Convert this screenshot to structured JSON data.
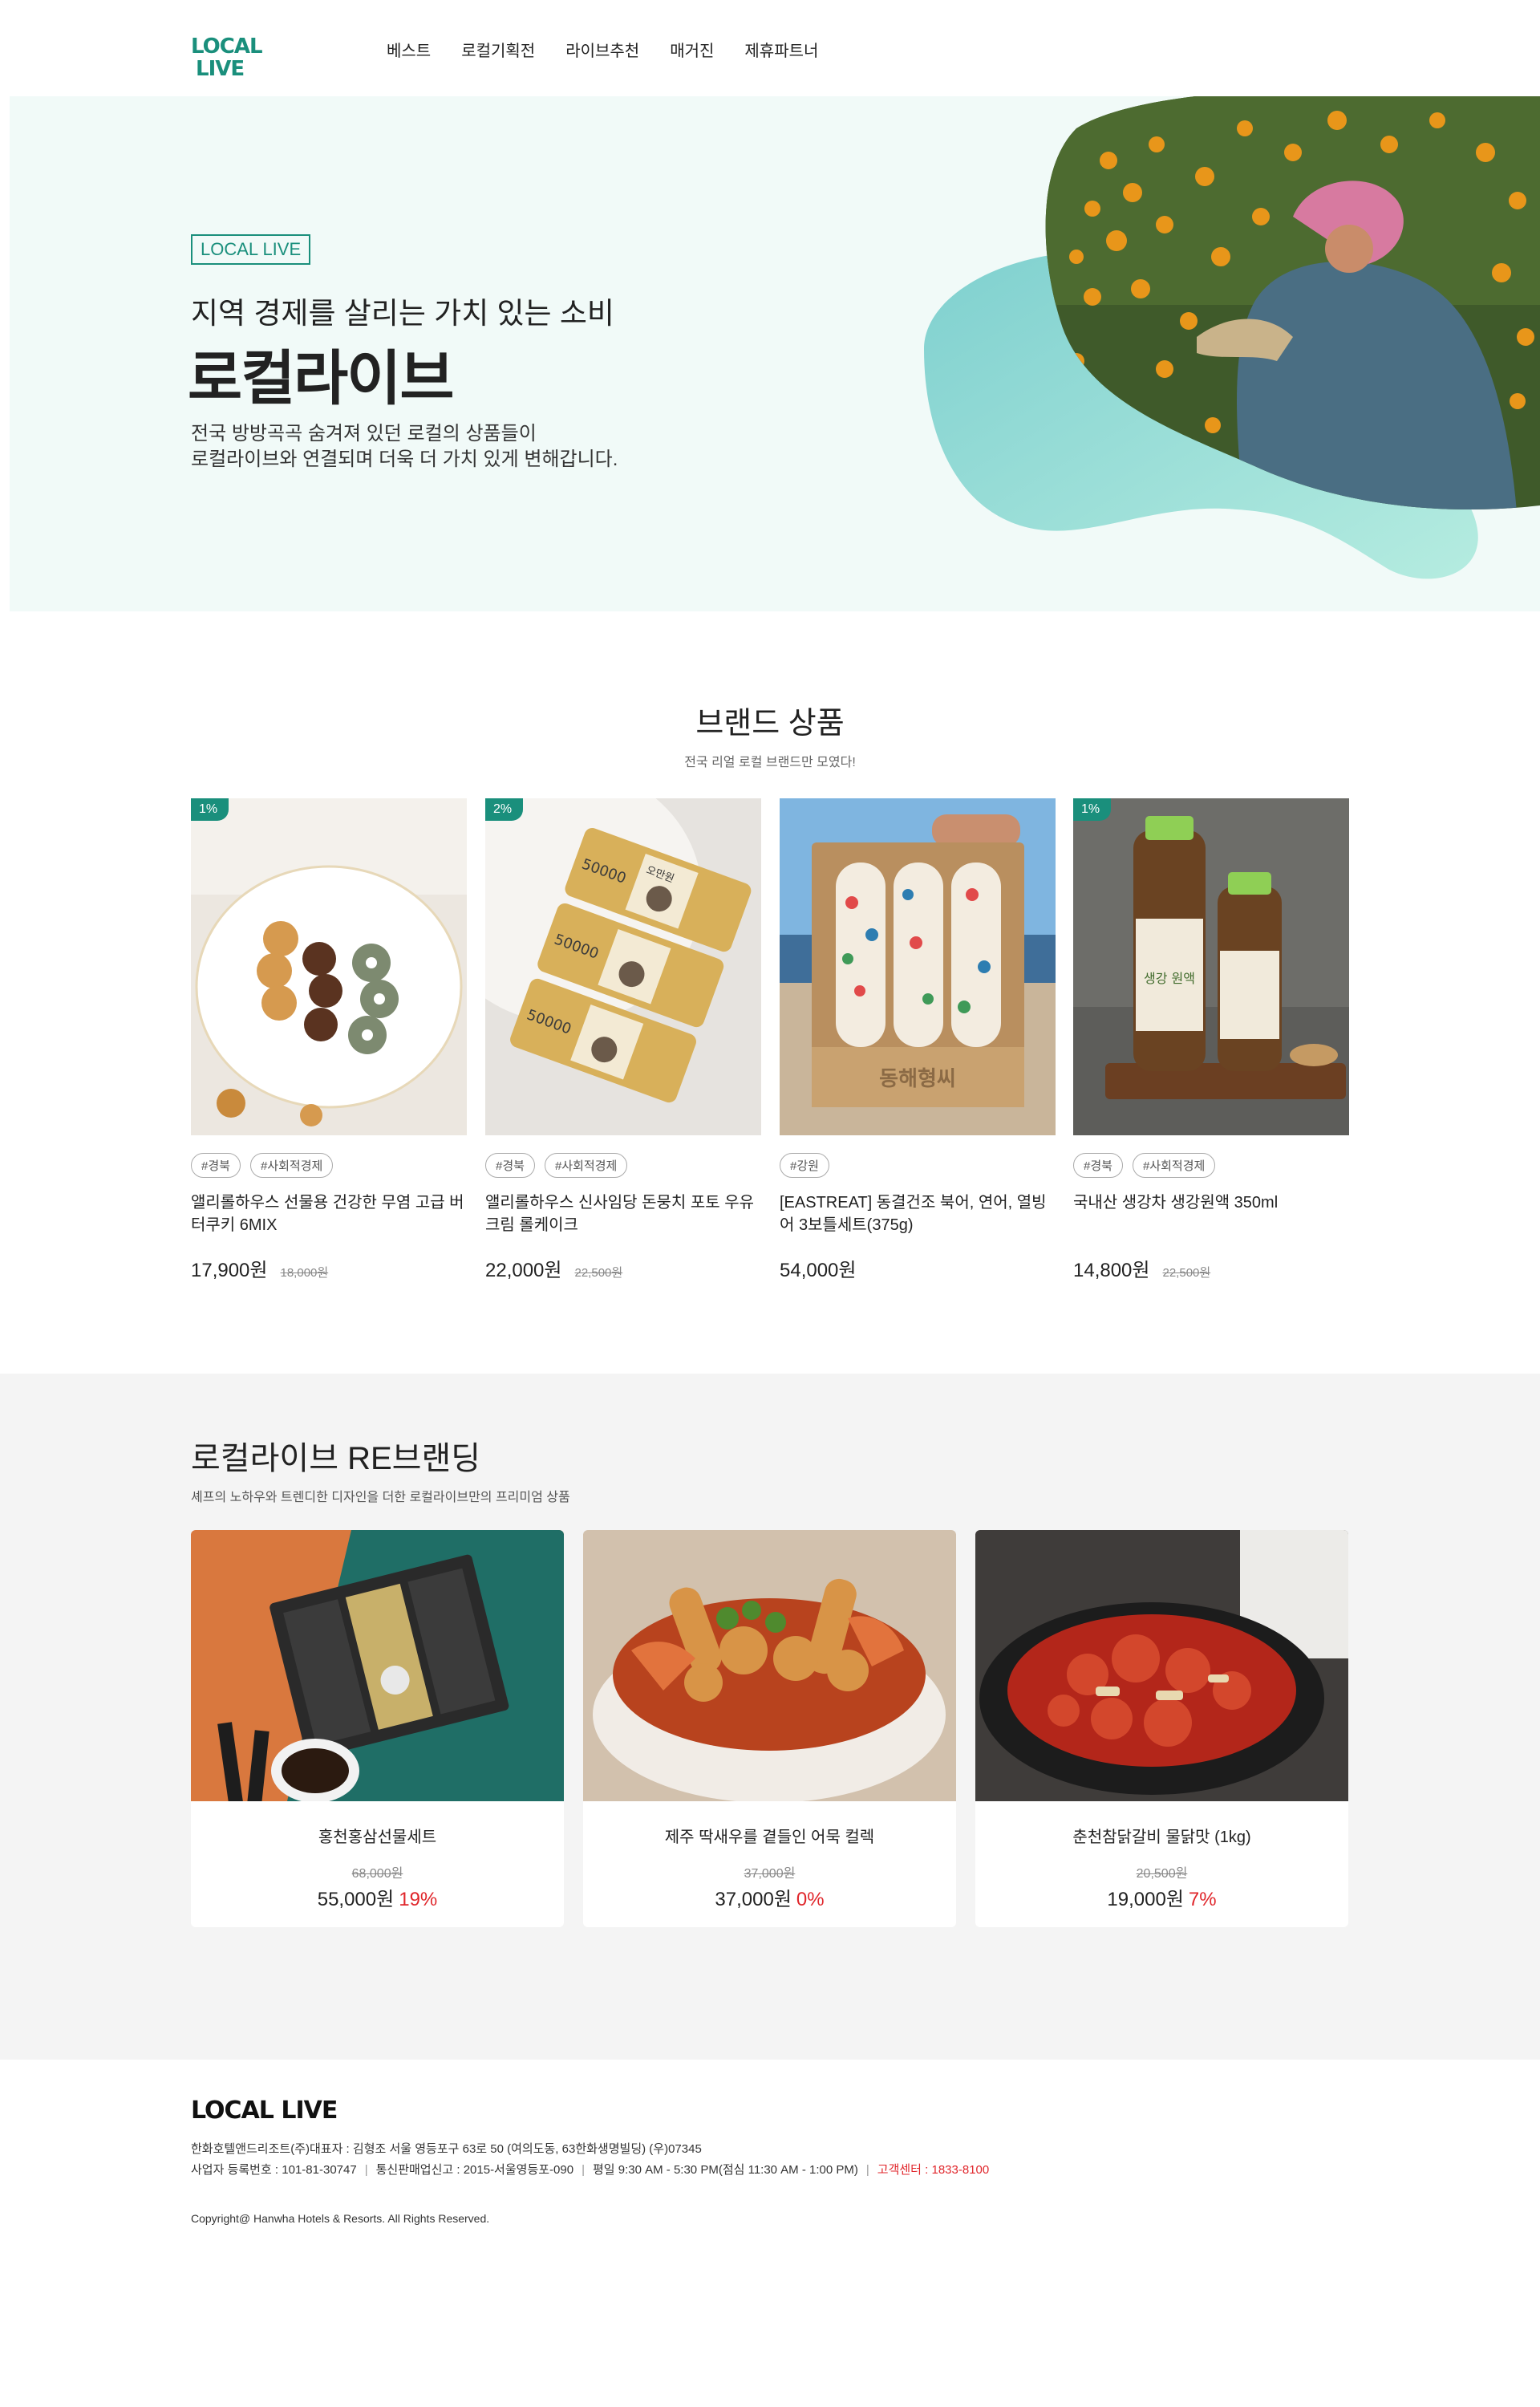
{
  "header": {
    "logo_top": "LOCAL",
    "logo_bottom": "LIVE",
    "nav": [
      "베스트",
      "로컬기획전",
      "라이브추천",
      "매거진",
      "제휴파트너"
    ]
  },
  "hero": {
    "badge": "LOCAL LIVE",
    "subtitle": "지역 경제를 살리는 가치 있는 소비",
    "title": "로컬라이브",
    "desc_line1": "전국 방방곡곡 숨겨져 있던 로컬의 상품들이",
    "desc_line2": "로컬라이브와 연결되며 더욱 더 가치 있게 변해갑니다."
  },
  "brand": {
    "title": "브랜드 상품",
    "subtitle": "전국 리얼 로컬 브랜드만 모였다!",
    "products": [
      {
        "badge": "1%",
        "tags": [
          "#경북",
          "#사회적경제"
        ],
        "name": "앨리롤하우스 선물용 건강한 무염 고급 버터쿠키 6MIX",
        "price": "17,900원",
        "orig": "18,000원"
      },
      {
        "badge": "2%",
        "tags": [
          "#경북",
          "#사회적경제"
        ],
        "name": "앨리롤하우스 신사임당 돈뭉치 포토 우유크림 롤케이크",
        "price": "22,000원",
        "orig": "22,500원"
      },
      {
        "badge": "",
        "tags": [
          "#강원"
        ],
        "name": "[EASTREAT] 동결건조 북어, 연어, 열빙어 3보틀세트(375g)",
        "price": "54,000원",
        "orig": ""
      },
      {
        "badge": "1%",
        "tags": [
          "#경북",
          "#사회적경제"
        ],
        "name": "국내산 생강차 생강원액 350ml",
        "price": "14,800원",
        "orig": "22,500원"
      }
    ],
    "img_labels": {
      "money": "50000",
      "money_name": "오만원",
      "box": "동해형씨",
      "bottle": "생강 원액"
    }
  },
  "rebrand": {
    "title": "로컬라이브 RE브랜딩",
    "subtitle": "셰프의 노하우와 트렌디한 디자인을 더한 로컬라이브만의 프리미엄 상품",
    "cards": [
      {
        "name": "홍천홍삼선물세트",
        "orig": "68,000원",
        "price": "55,000원",
        "pct": "19%"
      },
      {
        "name": "제주 딱새우를 곁들인 어묵 컬렉",
        "orig": "37,000원",
        "price": "37,000원",
        "pct": "0%"
      },
      {
        "name": "춘천참닭갈비 물닭맛 (1kg)",
        "orig": "20,500원",
        "price": "19,000원",
        "pct": "7%"
      }
    ]
  },
  "footer": {
    "logo": "LOCAL LIVE",
    "line1": "한화호텔앤드리조트(주)대표자 : 김형조 서울 영등포구 63로 50 (여의도동, 63한화생명빌딩) (우)07345",
    "reg": "사업자 등록번호 : 101-81-30747",
    "mail": "통신판매업신고 : 2015-서울영등포-090",
    "hours": "평일 9:30 AM - 5:30 PM(점심 11:30 AM - 1:00 PM)",
    "cs": "고객센터 : 1833-8100",
    "copyright": "Copyright@ Hanwha Hotels & Resorts. All Rights Reserved."
  },
  "colors": {
    "brand": "#1a8f7c",
    "accent_red": "#e0262b",
    "hero_bg": "#f1faf8",
    "section_bg": "#f4f4f4"
  }
}
